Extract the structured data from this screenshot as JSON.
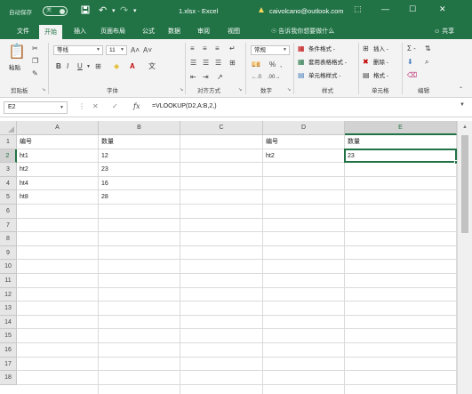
{
  "titlebar": {
    "autosave_label": "自动保存",
    "autosave_state": "关",
    "save_icon": "save-icon",
    "undo_icon": "undo-icon",
    "redo_icon": "redo-icon",
    "customize_icon": "customize-qat-icon",
    "doc_title": "1.xlsx - Excel",
    "account_email": "caivolcano@outlook.com",
    "warning_icon": "warning-icon",
    "ribbon_display_icon": "ribbon-display-icon",
    "minimize_icon": "minimize-icon",
    "maximize_icon": "maximize-icon",
    "close_icon": "close-icon"
  },
  "tabs": [
    {
      "label": "文件",
      "active": false
    },
    {
      "label": "开始",
      "active": true
    },
    {
      "label": "插入",
      "active": false
    },
    {
      "label": "页面布局",
      "active": false
    },
    {
      "label": "公式",
      "active": false
    },
    {
      "label": "数据",
      "active": false
    },
    {
      "label": "审阅",
      "active": false
    },
    {
      "label": "视图",
      "active": false
    }
  ],
  "tellme": "告诉我你想要做什么",
  "share": "共享",
  "ribbon": {
    "clipboard": {
      "paste": "粘贴",
      "label": "剪贴板"
    },
    "font": {
      "name": "等线",
      "size": "11",
      "label": "字体",
      "bold": "B",
      "italic": "I",
      "underline": "U"
    },
    "alignment": {
      "label": "对齐方式"
    },
    "number": {
      "format": "常规",
      "label": "数字",
      "percent": "%",
      "comma": ","
    },
    "styles": {
      "conditional": "条件格式 -",
      "table": "套用表格格式 -",
      "cell": "单元格样式 -",
      "label": "样式"
    },
    "cells": {
      "insert": "插入 -",
      "delete": "删除 -",
      "format": "格式 -",
      "label": "单元格"
    },
    "editing": {
      "label": "编辑"
    }
  },
  "formula_bar": {
    "name_box": "E2",
    "cancel_icon": "cancel-icon",
    "enter_icon": "enter-icon",
    "fx": "fx",
    "formula": "=VLOOKUP(D2,A:B,2,)"
  },
  "sheet": {
    "columns": [
      "A",
      "B",
      "C",
      "D",
      "E"
    ],
    "rows": [
      "1",
      "2",
      "3",
      "4",
      "5",
      "6",
      "7",
      "8",
      "9",
      "10",
      "11",
      "12",
      "13",
      "14",
      "15",
      "16",
      "17",
      "18"
    ],
    "selected_column": "E",
    "selected_row": "2",
    "cells": {
      "A1": "编号",
      "B1": "数量",
      "D1": "编号",
      "E1": "数量",
      "A2": "ht1",
      "B2": "12",
      "D2": "ht2",
      "E2": "23",
      "A3": "ht2",
      "B3": "23",
      "A4": "ht4",
      "B4": "16",
      "A5": "ht8",
      "B5": "28"
    }
  }
}
